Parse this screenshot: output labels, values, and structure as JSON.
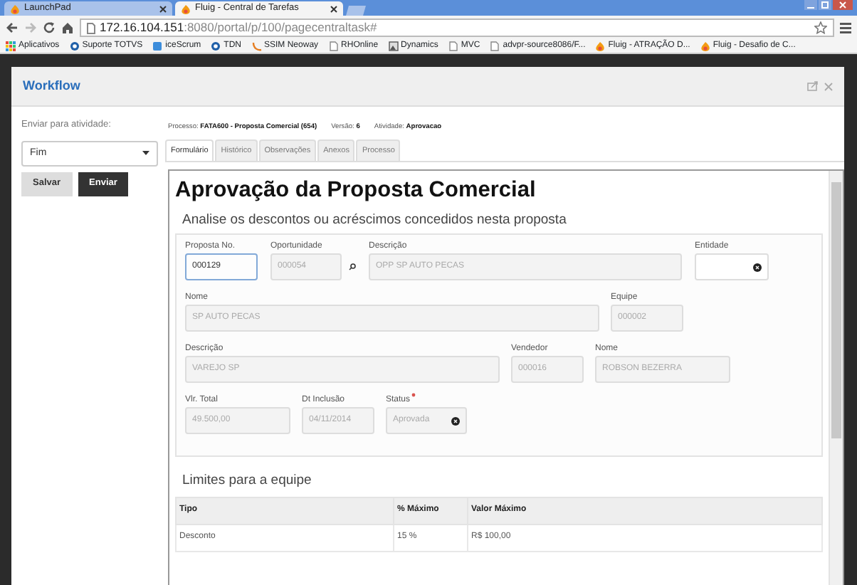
{
  "browser": {
    "tabs": [
      {
        "title": "LaunchPad",
        "selected": false
      },
      {
        "title": "Fluig - Central de Tarefas",
        "selected": true
      }
    ],
    "address": {
      "host": "172.16.104.151",
      "path": ":8080/portal/p/100/pagecentraltask#"
    },
    "bookmarks": [
      {
        "label": "Aplicativos",
        "kind": "apps"
      },
      {
        "label": "Suporte TOTVS",
        "kind": "circle"
      },
      {
        "label": "iceScrum",
        "kind": "square"
      },
      {
        "label": "TDN",
        "kind": "circle"
      },
      {
        "label": "SSIM Neoway",
        "kind": "swoosh"
      },
      {
        "label": "RHOnline",
        "kind": "page"
      },
      {
        "label": "Dynamics",
        "kind": "picture"
      },
      {
        "label": "MVC",
        "kind": "page"
      },
      {
        "label": "advpr-source8086/F...",
        "kind": "page"
      },
      {
        "label": "Fluig - ATRAÇÃO D...",
        "kind": "flame"
      },
      {
        "label": "Fluig - Desafio de C...",
        "kind": "flame"
      }
    ]
  },
  "modal": {
    "title": "Workflow",
    "send_label": "Enviar para atividade:",
    "activity": "Fim",
    "buttons": [
      {
        "label": "Salvar",
        "kind": "secondary"
      },
      {
        "label": "Enviar",
        "kind": "primary"
      }
    ],
    "info": [
      "Processo: **FATA600 - Proposta Comercial (654)**",
      "Versão: **6**",
      "Atividade: **Aprovacao**"
    ],
    "tabs": [
      {
        "label": "Formulário",
        "selected": true
      },
      {
        "label": "Histórico",
        "selected": false
      },
      {
        "label": "Observações",
        "selected": false
      },
      {
        "label": "Anexos",
        "selected": false
      },
      {
        "label": "Processo",
        "selected": false
      }
    ],
    "form": {
      "title": "Aprovação da Proposta Comercial",
      "subtitle": "Analise os descontos ou acréscimos concedidos nesta proposta",
      "rows": [
        [
          {
            "label": "Proposta No.",
            "value": "000129",
            "kind": "text",
            "disabled": false,
            "focused": true
          },
          {
            "label": "Oportunidade",
            "value": "000054",
            "kind": "lookup",
            "disabled": true
          },
          {
            "label": "Descrição",
            "value": "OPP SP AUTO PECAS",
            "kind": "text",
            "disabled": true
          },
          {
            "label": "Entidade",
            "kind": "select",
            "disabled": false
          }
        ],
        [
          {
            "label": "Nome",
            "value": "SP AUTO PECAS",
            "kind": "text",
            "disabled": true
          },
          {
            "label": "Equipe",
            "value": "000002",
            "kind": "text",
            "disabled": true
          }
        ],
        [
          {
            "label": "Descrição",
            "value": "VAREJO SP",
            "kind": "text",
            "disabled": true
          },
          {
            "label": "Vendedor",
            "value": "000016",
            "kind": "text",
            "disabled": true
          },
          {
            "label": "Nome",
            "value": "ROBSON BEZERRA",
            "kind": "text",
            "disabled": true
          }
        ],
        [
          {
            "label": "Vlr. Total",
            "value": "49.500,00",
            "kind": "text",
            "disabled": true
          },
          {
            "label": "Dt Inclusão",
            "value": "04/11/2014",
            "kind": "text",
            "disabled": true
          },
          {
            "label": "Status",
            "value": "Aprovada",
            "kind": "select",
            "disabled": true,
            "required": true
          }
        ]
      ],
      "limits_title": "Limites para a equipe",
      "table": {
        "columns": [
          "Tipo",
          "% Máximo",
          "Valor Máximo"
        ],
        "rows": [
          [
            "Desconto",
            "15 %",
            "R$ 100,00"
          ]
        ]
      }
    }
  }
}
